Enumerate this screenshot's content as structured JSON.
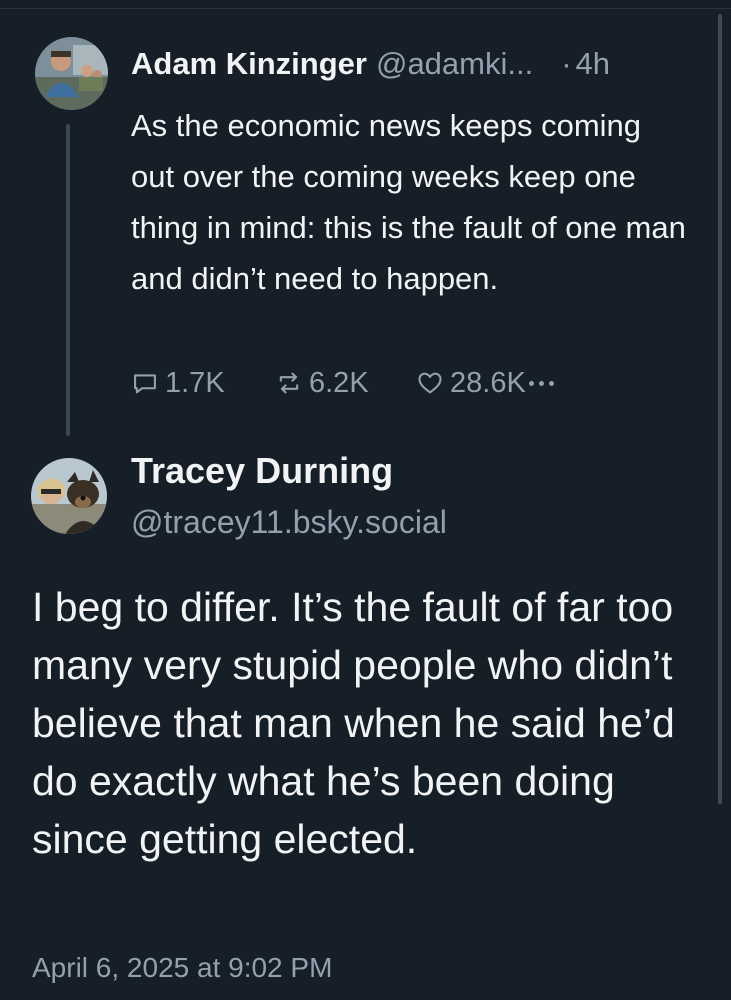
{
  "parent_post": {
    "author_name": "Adam Kinzinger",
    "author_handle": "@adamki...",
    "separator": "·",
    "time": "4h",
    "text": "As the economic news keeps coming out over the coming weeks keep one thing in mind: this is the fault of one man and didn’t need to happen.",
    "actions": {
      "replies": "1.7K",
      "reposts": "6.2K",
      "likes": "28.6K"
    }
  },
  "main_post": {
    "author_name": "Tracey Durning",
    "author_handle": "@tracey11.bsky.social",
    "text": "I beg to differ. It’s the fault of far too many very stupid people who didn’t believe that man when he said he’d do exactly what he’s been doing since getting elected.",
    "timestamp": "April 6, 2025 at 9:02 PM"
  },
  "colors": {
    "background": "#161e27",
    "text_primary": "#f1f3f5",
    "text_secondary": "#93a0ae",
    "thread_line": "#3b4754"
  },
  "icons": {
    "reply": "reply-bubble-icon",
    "repost": "repost-arrows-icon",
    "like": "heart-outline-icon",
    "more": "ellipsis-icon"
  }
}
